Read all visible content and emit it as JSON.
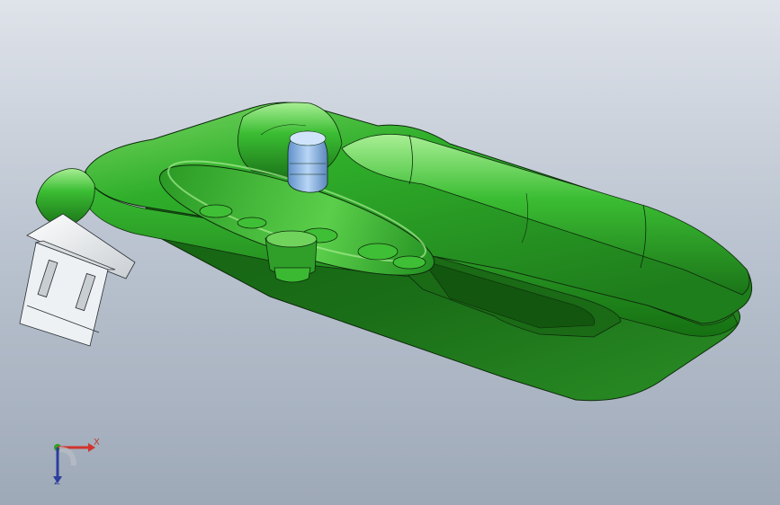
{
  "viewport": {
    "background_top": "#dfe3ea",
    "background_bottom": "#9ea9b8"
  },
  "model": {
    "part_color": "#2ea12a",
    "part_highlight": "#8ee37a",
    "part_shadow": "#175e15",
    "edge_color": "#0e2a0c",
    "connector_color": "#e9ecee",
    "fitting_color": "#86b3e6"
  },
  "triad": {
    "x_label": "X",
    "z_label": "Z",
    "x_color": "#d0342c",
    "y_color": "#2ea12a",
    "z_color": "#2c3e9e"
  }
}
